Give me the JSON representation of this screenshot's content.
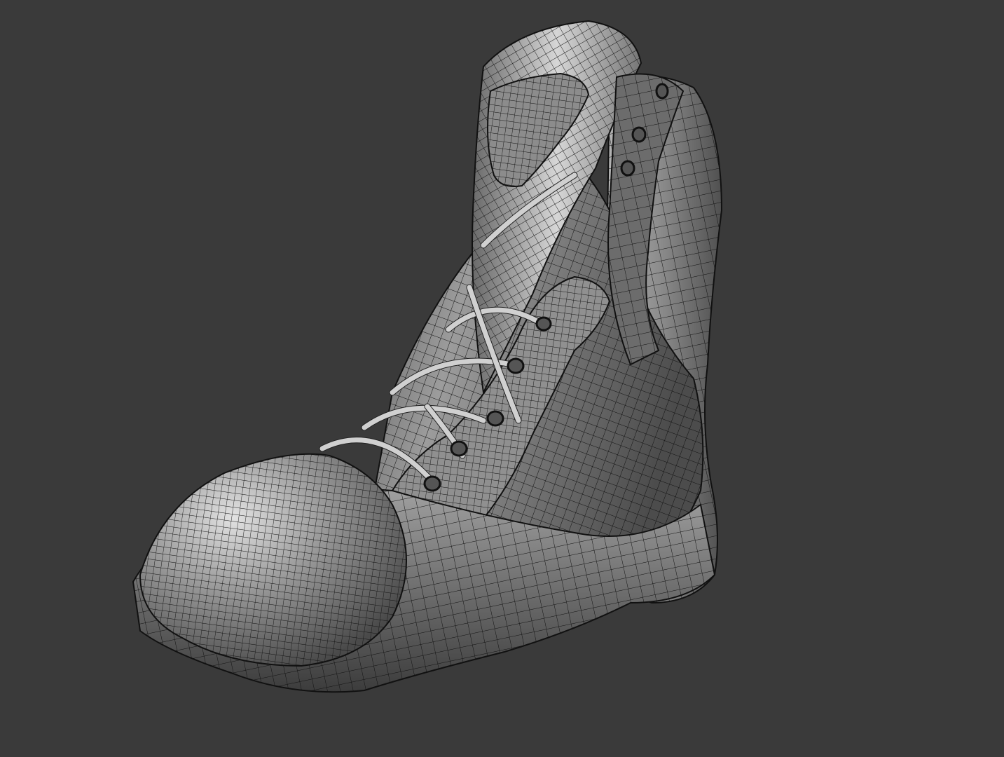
{
  "viewport": {
    "background": "#3a3a3a",
    "display_mode": "shaded-with-wireframe",
    "model": "boot-mesh",
    "shading": {
      "highlight": "#e6e6e6",
      "midtone": "#8a8a8a",
      "shadow": "#3f3f3f",
      "wire": "#111111"
    },
    "mesh_parts": [
      "collar-padding",
      "tongue",
      "heel-counter",
      "quarter-panel",
      "vamp",
      "toe-cap",
      "midsole",
      "outsole",
      "laces",
      "eyelets"
    ]
  }
}
